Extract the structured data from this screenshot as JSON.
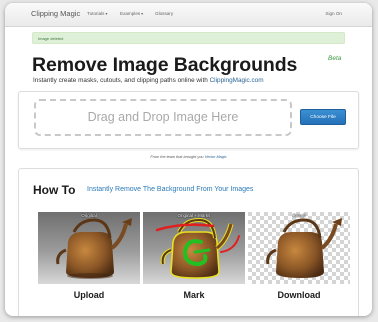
{
  "navbar": {
    "brand": "Clipping Magic",
    "items": [
      {
        "label": "Tutorials",
        "caret": "▾"
      },
      {
        "label": "Examples",
        "caret": "▾"
      },
      {
        "label": "Glossary",
        "caret": ""
      }
    ],
    "sign_in": "Sign On"
  },
  "alert": {
    "text": "Image deleted"
  },
  "hero": {
    "title": "Remove Image Backgrounds",
    "beta": "Beta",
    "subtitle_prefix": "Instantly create masks, cutouts, and clipping paths online with ",
    "subtitle_link": "ClippingMagic.com"
  },
  "upload": {
    "dropzone_text": "Drag and Drop Image Here",
    "choose_button": "Choose File"
  },
  "credit": {
    "prefix": "From the team that brought you ",
    "link": "Vector Magic"
  },
  "howto": {
    "title": "How To",
    "subtitle": "Instantly Remove The Background From Your Images",
    "panels": [
      {
        "label": "Original",
        "step": "Upload"
      },
      {
        "label": "Original + Marks",
        "step": "Mark"
      },
      {
        "label": "Result",
        "step": "Download"
      }
    ]
  },
  "colors": {
    "link": "#2a6496",
    "button": "#2571b8",
    "alert_bg": "#dff0d8",
    "mark_green": "#22c022",
    "mark_red": "#e02020"
  }
}
